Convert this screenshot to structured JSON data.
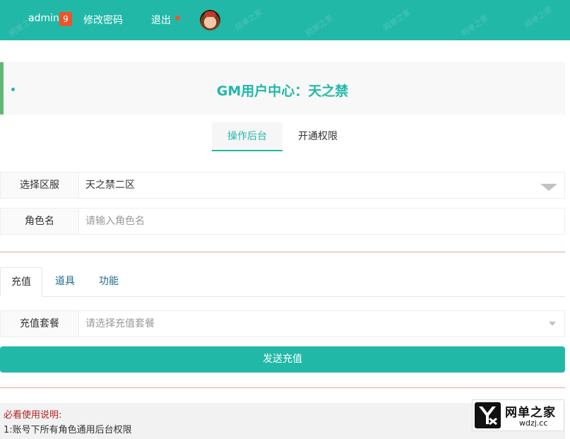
{
  "topbar": {
    "user": "admin",
    "badge": "9",
    "change_password": "修改密码",
    "logout": "退出",
    "watermark": "网单之家",
    "accent_color": "#22b8a8"
  },
  "header": {
    "title": "GM用户中心：天之禁"
  },
  "main_tabs": [
    {
      "label": "操作后台"
    },
    {
      "label": "开通权限"
    }
  ],
  "form": {
    "server": {
      "label": "选择区服",
      "value": "天之禁二区"
    },
    "role": {
      "label": "角色名",
      "placeholder": "请输入角色名"
    }
  },
  "sub_tabs": [
    {
      "label": "充值"
    },
    {
      "label": "道具"
    },
    {
      "label": "功能"
    }
  ],
  "recharge": {
    "label": "充值套餐",
    "placeholder": "请选择充值套餐",
    "button": "发送充值"
  },
  "notes": {
    "title": "必看使用说明:",
    "line1": "1:账号下所有角色通用后台权限"
  },
  "logo": {
    "name": "网单之家",
    "url": "wdzj.cc",
    "icon": "yx-logo-icon"
  }
}
